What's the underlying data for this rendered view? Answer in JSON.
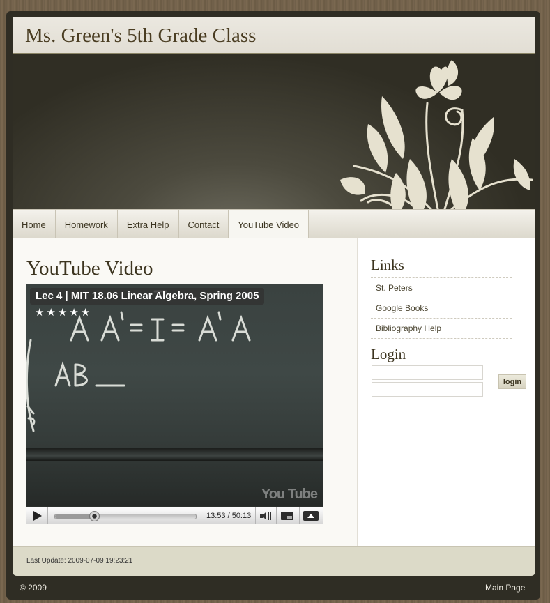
{
  "site": {
    "title": "Ms. Green's 5th Grade Class"
  },
  "nav": {
    "items": [
      {
        "label": "Home",
        "active": false
      },
      {
        "label": "Homework",
        "active": false
      },
      {
        "label": "Extra Help",
        "active": false
      },
      {
        "label": "Contact",
        "active": false
      },
      {
        "label": "YouTube Video",
        "active": true
      }
    ]
  },
  "main": {
    "heading": "YouTube Video",
    "video": {
      "title": "Lec 4 | MIT 18.06 Linear Algebra, Spring 2005",
      "rating_stars": "★★★★★",
      "time": "13:53 / 50:13",
      "progress": 0.276,
      "watermark": "You Tube"
    }
  },
  "sidebar": {
    "links_heading": "Links",
    "links": [
      "St. Peters",
      "Google Books",
      "Bibliography Help"
    ],
    "login_heading": "Login",
    "login_button": "login"
  },
  "footer": {
    "last_update": "Last Update: 2009-07-09 19:23:21",
    "copyright": "© 2009",
    "main_page": "Main Page"
  }
}
